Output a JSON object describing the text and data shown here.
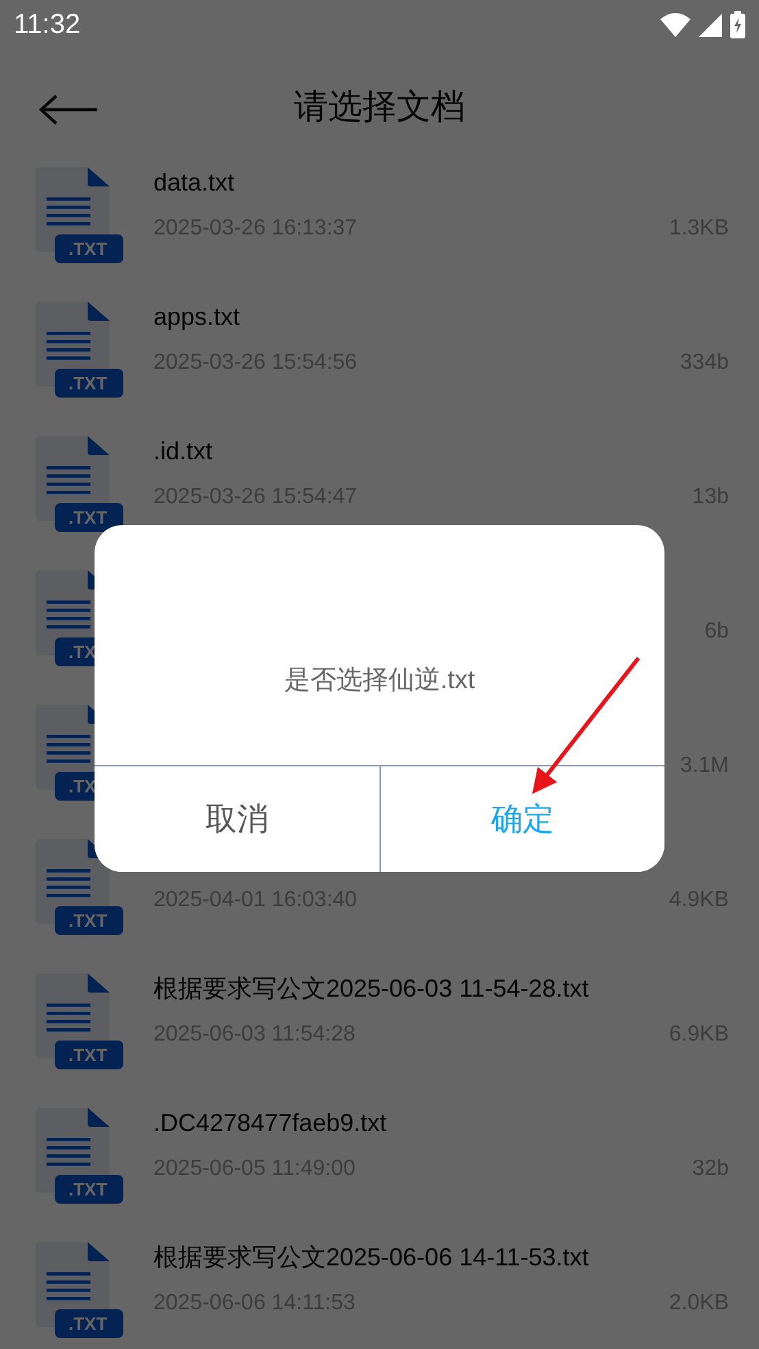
{
  "status_bar": {
    "time": "11:32"
  },
  "header": {
    "title": "请选择文档"
  },
  "files": [
    {
      "badge": ".TXT",
      "name": "data.txt",
      "date": "2025-03-26 16:13:37",
      "size": "1.3KB"
    },
    {
      "badge": ".TXT",
      "name": "apps.txt",
      "date": "2025-03-26 15:54:56",
      "size": "334b"
    },
    {
      "badge": ".TXT",
      "name": ".id.txt",
      "date": "2025-03-26 15:54:47",
      "size": "13b"
    },
    {
      "badge": ".TX",
      "size": "6b"
    },
    {
      "badge": ".TX",
      "size": "3.1M"
    },
    {
      "badge": ".TXT",
      "date": "2025-04-01 16:03:40",
      "size": "4.9KB"
    },
    {
      "badge": ".TXT",
      "name": "根据要求写公文2025-06-03 11-54-28.txt",
      "date": "2025-06-03 11:54:28",
      "size": "6.9KB"
    },
    {
      "badge": ".TXT",
      "name": ".DC4278477faeb9.txt",
      "date": "2025-06-05 11:49:00",
      "size": "32b"
    },
    {
      "badge": ".TXT",
      "name": "根据要求写公文2025-06-06 14-11-53.txt",
      "date": "2025-06-06 14:11:53",
      "size": "2.0KB"
    }
  ],
  "dialog": {
    "message": "是否选择仙逆.txt",
    "buttons": [
      {
        "label": "取消",
        "kind": "cancel"
      },
      {
        "label": "确定",
        "kind": "confirm"
      }
    ]
  }
}
